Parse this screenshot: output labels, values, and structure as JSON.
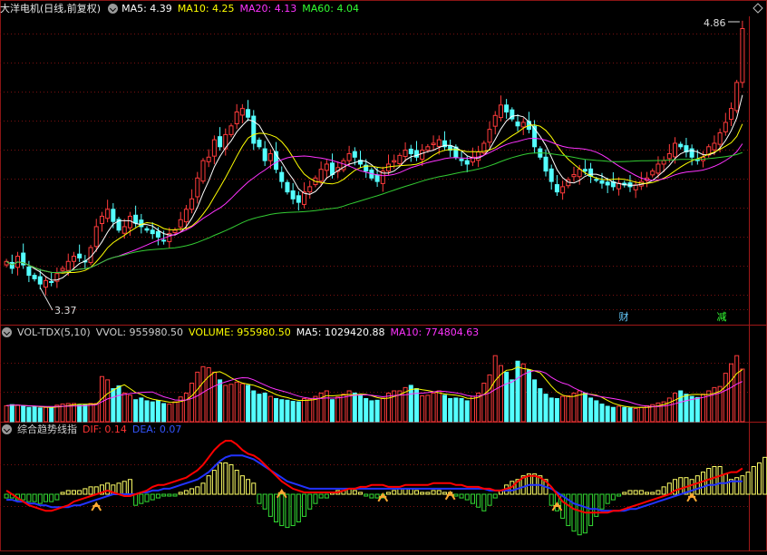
{
  "price_header": {
    "title": "大洋电机(日线,前复权)",
    "ma5": "MA5: 4.39",
    "ma10": "MA10: 4.25",
    "ma20": "MA20: 4.13",
    "ma60": "MA60: 4.04"
  },
  "volume_header": {
    "title": "VOL-TDX(5,10)",
    "vvol": "VVOL: 955980.50",
    "volume": "VOLUME: 955980.50",
    "ma5": "MA5: 1029420.88",
    "ma10": "MA10: 774804.63"
  },
  "macd_header": {
    "title": "综合趋势线指",
    "dif": "DIF: 0.14",
    "dea": "DEA: 0.07"
  },
  "annotations": {
    "high_label": "4.86",
    "low_label": "3.37",
    "tag_cai": "财",
    "tag_jian": "减"
  },
  "colors": {
    "up": "#ff3b3b",
    "down": "#54ffff",
    "ma5": "#ffffff",
    "ma10": "#ffff00",
    "ma20": "#ff33ff",
    "ma60": "#33cc33",
    "dif": "#ff0000",
    "dea": "#2233ff",
    "hist_up": "#ffff66",
    "hist_down": "#33dd33",
    "grid": "#7a1010"
  },
  "chart_data": {
    "type": "candlestick",
    "price_range": [
      3.25,
      4.92
    ],
    "closes": [
      3.52,
      3.48,
      3.55,
      3.5,
      3.44,
      3.42,
      3.39,
      3.41,
      3.4,
      3.45,
      3.48,
      3.52,
      3.55,
      3.54,
      3.52,
      3.6,
      3.72,
      3.78,
      3.82,
      3.75,
      3.7,
      3.72,
      3.78,
      3.74,
      3.72,
      3.7,
      3.68,
      3.66,
      3.64,
      3.68,
      3.7,
      3.76,
      3.82,
      3.88,
      4.0,
      4.1,
      4.12,
      4.22,
      4.18,
      4.25,
      4.3,
      4.38,
      4.4,
      4.35,
      4.2,
      4.18,
      4.1,
      4.14,
      4.05,
      3.98,
      3.92,
      3.88,
      3.86,
      3.92,
      3.95,
      4.0,
      4.05,
      4.08,
      4.02,
      4.06,
      4.1,
      4.14,
      4.12,
      4.08,
      4.04,
      4.0,
      3.98,
      4.04,
      4.08,
      4.1,
      4.13,
      4.16,
      4.14,
      4.12,
      4.16,
      4.18,
      4.2,
      4.22,
      4.18,
      4.16,
      4.12,
      4.1,
      4.08,
      4.12,
      4.15,
      4.2,
      4.28,
      4.36,
      4.42,
      4.38,
      4.34,
      4.3,
      4.32,
      4.28,
      4.18,
      4.12,
      4.04,
      3.98,
      3.92,
      3.95,
      3.99,
      4.02,
      4.05,
      4.04,
      4.01,
      3.99,
      3.97,
      3.96,
      3.95,
      3.97,
      3.96,
      3.95,
      3.96,
      3.98,
      4.0,
      4.04,
      4.08,
      4.1,
      4.14,
      4.2,
      4.18,
      4.15,
      4.12,
      4.1,
      4.12,
      4.18,
      4.2,
      4.26,
      4.32,
      4.4,
      4.55,
      4.86
    ],
    "volume_range": [
      0,
      1450000
    ],
    "volumes": [
      290000,
      310000,
      300000,
      280000,
      260000,
      270000,
      250000,
      260000,
      255000,
      300000,
      320000,
      330000,
      330000,
      300000,
      310000,
      330000,
      330000,
      820000,
      760000,
      600000,
      650000,
      520000,
      480000,
      400000,
      430000,
      380000,
      360000,
      380000,
      330000,
      320000,
      360000,
      450000,
      520000,
      700000,
      900000,
      1000000,
      980000,
      900000,
      760000,
      660000,
      680000,
      720000,
      690000,
      660000,
      560000,
      500000,
      520000,
      460000,
      420000,
      400000,
      390000,
      370000,
      360000,
      420000,
      410000,
      460000,
      520000,
      560000,
      400000,
      450000,
      500000,
      560000,
      520000,
      480000,
      420000,
      380000,
      390000,
      430000,
      520000,
      560000,
      560000,
      620000,
      660000,
      600000,
      470000,
      480000,
      520000,
      560000,
      480000,
      420000,
      430000,
      420000,
      380000,
      460000,
      520000,
      700000,
      850000,
      1200000,
      1020000,
      900000,
      760000,
      1100000,
      1050000,
      940000,
      760000,
      600000,
      500000,
      430000,
      420000,
      460000,
      470000,
      520000,
      560000,
      520000,
      430000,
      380000,
      320000,
      280000,
      260000,
      280000,
      260000,
      250000,
      240000,
      260000,
      290000,
      310000,
      340000,
      360000,
      430000,
      520000,
      560000,
      500000,
      460000,
      440000,
      500000,
      560000,
      620000,
      640000,
      880000,
      1050000,
      1200000,
      955980
    ],
    "macd_range": [
      -0.3,
      0.3
    ],
    "hist": [
      -0.02,
      -0.02,
      -0.03,
      -0.03,
      -0.04,
      -0.04,
      -0.05,
      -0.04,
      -0.04,
      -0.03,
      0.01,
      0.02,
      0.02,
      0.02,
      0.03,
      0.04,
      0.04,
      0.05,
      0.06,
      0.05,
      0.06,
      0.07,
      0.08,
      -0.06,
      -0.05,
      -0.04,
      -0.03,
      -0.02,
      -0.01,
      -0.01,
      -0.01,
      0.01,
      0.02,
      0.03,
      0.04,
      0.06,
      0.1,
      0.13,
      0.17,
      0.17,
      0.16,
      0.13,
      0.1,
      0.08,
      0.06,
      -0.05,
      -0.08,
      -0.12,
      -0.15,
      -0.17,
      -0.18,
      -0.17,
      -0.15,
      -0.12,
      -0.08,
      -0.05,
      -0.02,
      -0.02,
      0.01,
      0.02,
      0.02,
      0.03,
      0.02,
      0.01,
      -0.01,
      -0.02,
      -0.02,
      -0.02,
      0.01,
      0.02,
      0.03,
      0.03,
      0.03,
      0.02,
      0.01,
      0.01,
      0.02,
      0.02,
      0.01,
      0.01,
      -0.01,
      -0.02,
      -0.03,
      -0.05,
      -0.07,
      -0.09,
      -0.06,
      -0.02,
      0.02,
      0.05,
      0.07,
      0.08,
      0.1,
      0.11,
      0.11,
      0.1,
      0.08,
      -0.06,
      -0.09,
      -0.13,
      -0.17,
      -0.2,
      -0.22,
      -0.21,
      -0.17,
      -0.12,
      -0.08,
      -0.05,
      -0.03,
      -0.01,
      0.01,
      0.02,
      0.02,
      0.02,
      0.01,
      0.01,
      0.02,
      0.04,
      0.06,
      0.08,
      0.09,
      0.09,
      0.08,
      0.1,
      0.12,
      0.14,
      0.15,
      0.15,
      0.11,
      0.08,
      0.09,
      0.1,
      0.12,
      0.15,
      0.17,
      0.2
    ],
    "dif": [
      0.02,
      0.0,
      -0.02,
      -0.04,
      -0.06,
      -0.07,
      -0.08,
      -0.09,
      -0.09,
      -0.08,
      -0.07,
      -0.06,
      -0.04,
      -0.03,
      -0.02,
      -0.01,
      0.0,
      0.01,
      0.02,
      0.01,
      0.0,
      -0.01,
      -0.01,
      0.0,
      0.01,
      0.02,
      0.04,
      0.05,
      0.05,
      0.06,
      0.07,
      0.08,
      0.09,
      0.11,
      0.13,
      0.16,
      0.2,
      0.24,
      0.27,
      0.29,
      0.29,
      0.27,
      0.24,
      0.22,
      0.21,
      0.19,
      0.16,
      0.13,
      0.1,
      0.07,
      0.05,
      0.03,
      0.02,
      0.01,
      0.01,
      0.01,
      0.01,
      0.01,
      0.01,
      0.01,
      0.02,
      0.03,
      0.03,
      0.04,
      0.04,
      0.05,
      0.05,
      0.05,
      0.04,
      0.04,
      0.04,
      0.05,
      0.05,
      0.05,
      0.05,
      0.05,
      0.06,
      0.06,
      0.06,
      0.06,
      0.05,
      0.05,
      0.04,
      0.04,
      0.04,
      0.03,
      0.03,
      0.02,
      0.02,
      0.03,
      0.04,
      0.07,
      0.09,
      0.1,
      0.1,
      0.09,
      0.07,
      0.04,
      0.0,
      -0.04,
      -0.06,
      -0.08,
      -0.09,
      -0.1,
      -0.1,
      -0.1,
      -0.1,
      -0.1,
      -0.09,
      -0.09,
      -0.08,
      -0.07,
      -0.06,
      -0.05,
      -0.04,
      -0.03,
      -0.02,
      -0.01,
      0.0,
      0.02,
      0.03,
      0.04,
      0.05,
      0.06,
      0.07,
      0.08,
      0.09,
      0.1,
      0.11,
      0.12,
      0.12,
      0.14
    ],
    "dea": [
      -0.03,
      -0.03,
      -0.04,
      -0.04,
      -0.05,
      -0.05,
      -0.06,
      -0.06,
      -0.07,
      -0.07,
      -0.07,
      -0.07,
      -0.06,
      -0.06,
      -0.05,
      -0.04,
      -0.03,
      -0.02,
      -0.01,
      0.0,
      0.0,
      0.0,
      0.0,
      0.0,
      0.01,
      0.01,
      0.02,
      0.02,
      0.03,
      0.03,
      0.04,
      0.05,
      0.06,
      0.07,
      0.08,
      0.1,
      0.12,
      0.15,
      0.18,
      0.2,
      0.21,
      0.21,
      0.21,
      0.2,
      0.19,
      0.17,
      0.15,
      0.13,
      0.11,
      0.09,
      0.07,
      0.06,
      0.05,
      0.04,
      0.03,
      0.03,
      0.03,
      0.03,
      0.03,
      0.03,
      0.03,
      0.03,
      0.03,
      0.03,
      0.03,
      0.03,
      0.03,
      0.03,
      0.03,
      0.03,
      0.03,
      0.03,
      0.03,
      0.03,
      0.03,
      0.03,
      0.03,
      0.03,
      0.03,
      0.03,
      0.03,
      0.03,
      0.03,
      0.03,
      0.03,
      0.03,
      0.02,
      0.02,
      0.02,
      0.02,
      0.02,
      0.03,
      0.04,
      0.05,
      0.05,
      0.05,
      0.04,
      0.03,
      0.01,
      -0.01,
      -0.03,
      -0.05,
      -0.06,
      -0.07,
      -0.08,
      -0.08,
      -0.09,
      -0.09,
      -0.09,
      -0.09,
      -0.09,
      -0.08,
      -0.08,
      -0.07,
      -0.06,
      -0.05,
      -0.04,
      -0.03,
      -0.02,
      -0.01,
      0.0,
      0.01,
      0.02,
      0.03,
      0.04,
      0.05,
      0.05,
      0.06,
      0.06,
      0.07,
      0.07,
      0.07
    ]
  }
}
